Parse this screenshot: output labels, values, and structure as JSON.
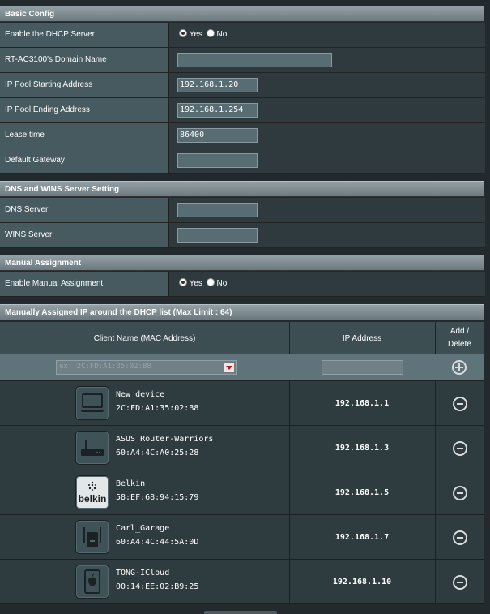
{
  "basic_config": {
    "title": "Basic Config",
    "dhcp_label": "Enable the DHCP Server",
    "yes": "Yes",
    "no": "No",
    "domain_label": "RT-AC3100's Domain Name",
    "domain_value": "",
    "pool_start_label": "IP Pool Starting Address",
    "pool_start_value": "192.168.1.20",
    "pool_end_label": "IP Pool Ending Address",
    "pool_end_value": "192.168.1.254",
    "lease_label": "Lease time",
    "lease_value": "86400",
    "gateway_label": "Default Gateway",
    "gateway_value": ""
  },
  "dns": {
    "title": "DNS and WINS Server Setting",
    "dns_label": "DNS Server",
    "dns_value": "",
    "wins_label": "WINS Server",
    "wins_value": ""
  },
  "manual": {
    "title": "Manual Assignment",
    "enable_label": "Enable Manual Assignment",
    "yes": "Yes",
    "no": "No"
  },
  "list": {
    "title": "Manually Assigned IP around the DHCP list (Max Limit : 64)",
    "col_client": "Client Name (MAC Address)",
    "col_ip": "IP Address",
    "col_action_1": "Add /",
    "col_action_2": "Delete",
    "mac_placeholder": "ex: 2C:FD:A1:35:02:B8",
    "clients": [
      {
        "name": "New device",
        "mac": "2C:FD:A1:35:02:B8",
        "ip": "192.168.1.1",
        "icon": "laptop-icon"
      },
      {
        "name": "ASUS Router-Warriors",
        "mac": "60:A4:4C:A0:25:28",
        "ip": "192.168.1.3",
        "icon": "router-icon"
      },
      {
        "name": "Belkin",
        "mac": "58:EF:68:94:15:79",
        "ip": "192.168.1.5",
        "icon": "belkin-logo-icon",
        "logo_text": "belkin"
      },
      {
        "name": "Carl_Garage",
        "mac": "60:A4:4C:44:5A:0D",
        "ip": "192.168.1.7",
        "icon": "range-extender-icon"
      },
      {
        "name": "TONG-ICloud",
        "mac": "00:14:EE:02:B9:25",
        "ip": "192.168.1.10",
        "icon": "apple-tablet-icon"
      }
    ]
  }
}
